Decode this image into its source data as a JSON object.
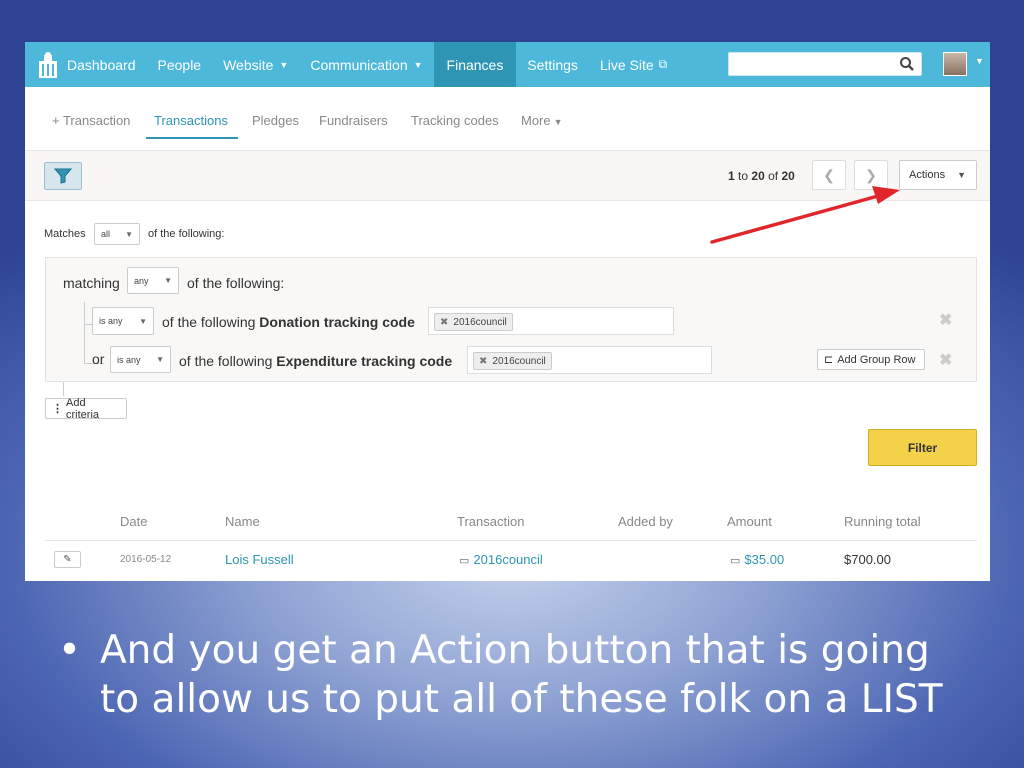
{
  "nav": {
    "items": [
      {
        "label": "Dashboard"
      },
      {
        "label": "People"
      },
      {
        "label": "Website"
      },
      {
        "label": "Communication"
      },
      {
        "label": "Finances"
      },
      {
        "label": "Settings"
      },
      {
        "label": "Live Site"
      }
    ],
    "search_placeholder": ""
  },
  "subtabs": [
    "+ Transaction",
    "Transactions",
    "Pledges",
    "Fundraisers",
    "Tracking codes",
    "More"
  ],
  "toolbar": {
    "pager_from": "1",
    "pager_to_word": "to",
    "pager_to": "20",
    "pager_of_word": "of",
    "pager_total": "20",
    "actions_label": "Actions"
  },
  "criteria": {
    "matches_label": "Matches",
    "matches_value": "all",
    "of_following": "of the following:",
    "group_matching_label": "matching",
    "group_matching_value": "any",
    "group_of_following": "of the following:",
    "rows": [
      {
        "prefix": "",
        "op": "is any",
        "text_pre": "of the following ",
        "field": "Donation tracking code",
        "token": "2016council"
      },
      {
        "prefix": "or",
        "op": "is any",
        "text_pre": "of the following ",
        "field": "Expenditure tracking code",
        "token": "2016council"
      }
    ],
    "add_group_row": "Add Group Row",
    "add_criteria": "Add criteria",
    "filter_button": "Filter"
  },
  "table": {
    "columns": [
      "Date",
      "Name",
      "Transaction",
      "Added by",
      "Amount",
      "Running total"
    ],
    "rows": [
      {
        "date": "2016-05-12",
        "name": "Lois Fussell",
        "transaction": "2016council",
        "added_by": "",
        "amount": "$35.00",
        "running_total": "$700.00"
      }
    ]
  },
  "slide": {
    "bullet": "And you get an Action button that is going to allow us to put all of these folk on a LIST"
  },
  "colors": {
    "nav_bg": "#4db8d9",
    "nav_active": "#2e95b4",
    "filter_button": "#f3d24a",
    "annotation_arrow": "#e0262a"
  }
}
